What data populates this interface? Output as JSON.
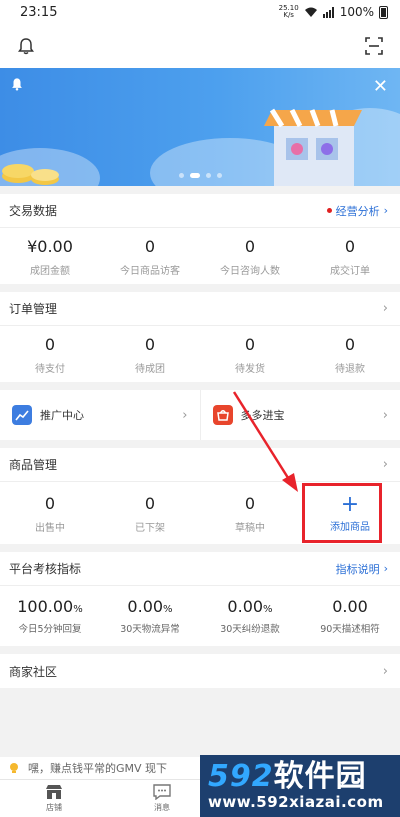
{
  "status_bar": {
    "time": "23:15",
    "net_speed_top": "25.10",
    "net_speed_bottom": "K/s",
    "battery": "100%"
  },
  "banner": {
    "dots": 4,
    "active_dot": 1
  },
  "trade": {
    "title": "交易数据",
    "link": "经营分析",
    "stats": [
      {
        "value": "¥0.00",
        "label": "成团金额"
      },
      {
        "value": "0",
        "label": "今日商品访客"
      },
      {
        "value": "0",
        "label": "今日咨询人数"
      },
      {
        "value": "0",
        "label": "成交订单"
      }
    ]
  },
  "orders": {
    "title": "订单管理",
    "stats": [
      {
        "value": "0",
        "label": "待支付"
      },
      {
        "value": "0",
        "label": "待成团"
      },
      {
        "value": "0",
        "label": "待发货"
      },
      {
        "value": "0",
        "label": "待退款"
      }
    ]
  },
  "tools": [
    {
      "label": "推广中心",
      "icon": "chart-icon",
      "color": "#3d7de0"
    },
    {
      "label": "多多进宝",
      "icon": "basket-icon",
      "color": "#e8452c"
    }
  ],
  "goods": {
    "title": "商品管理",
    "stats": [
      {
        "value": "0",
        "label": "出售中"
      },
      {
        "value": "0",
        "label": "已下架"
      },
      {
        "value": "0",
        "label": "草稿中"
      }
    ],
    "add_label": "添加商品"
  },
  "platform": {
    "title": "平台考核指标",
    "link": "指标说明",
    "metrics": [
      {
        "value": "100.00",
        "unit": "%",
        "label": "今日5分钟回复"
      },
      {
        "value": "0.00",
        "unit": "%",
        "label": "30天物流异常"
      },
      {
        "value": "0.00",
        "unit": "%",
        "label": "30天纠纷退款"
      },
      {
        "value": "0.00",
        "unit": "",
        "label": "90天描述相符"
      }
    ]
  },
  "community": {
    "title": "商家社区"
  },
  "notice": {
    "text": "嘿，赚点钱平常的GMV 现下"
  },
  "tabbar": {
    "tabs": [
      {
        "label": "店铺"
      },
      {
        "label": "消息"
      }
    ]
  },
  "watermark": {
    "brand_num": "592",
    "brand_text": "软件园",
    "url": "www.592xiazai.com"
  },
  "colors": {
    "accent": "#2b6fd6",
    "highlight": "#e8232b",
    "banner": "#4da0ee"
  }
}
